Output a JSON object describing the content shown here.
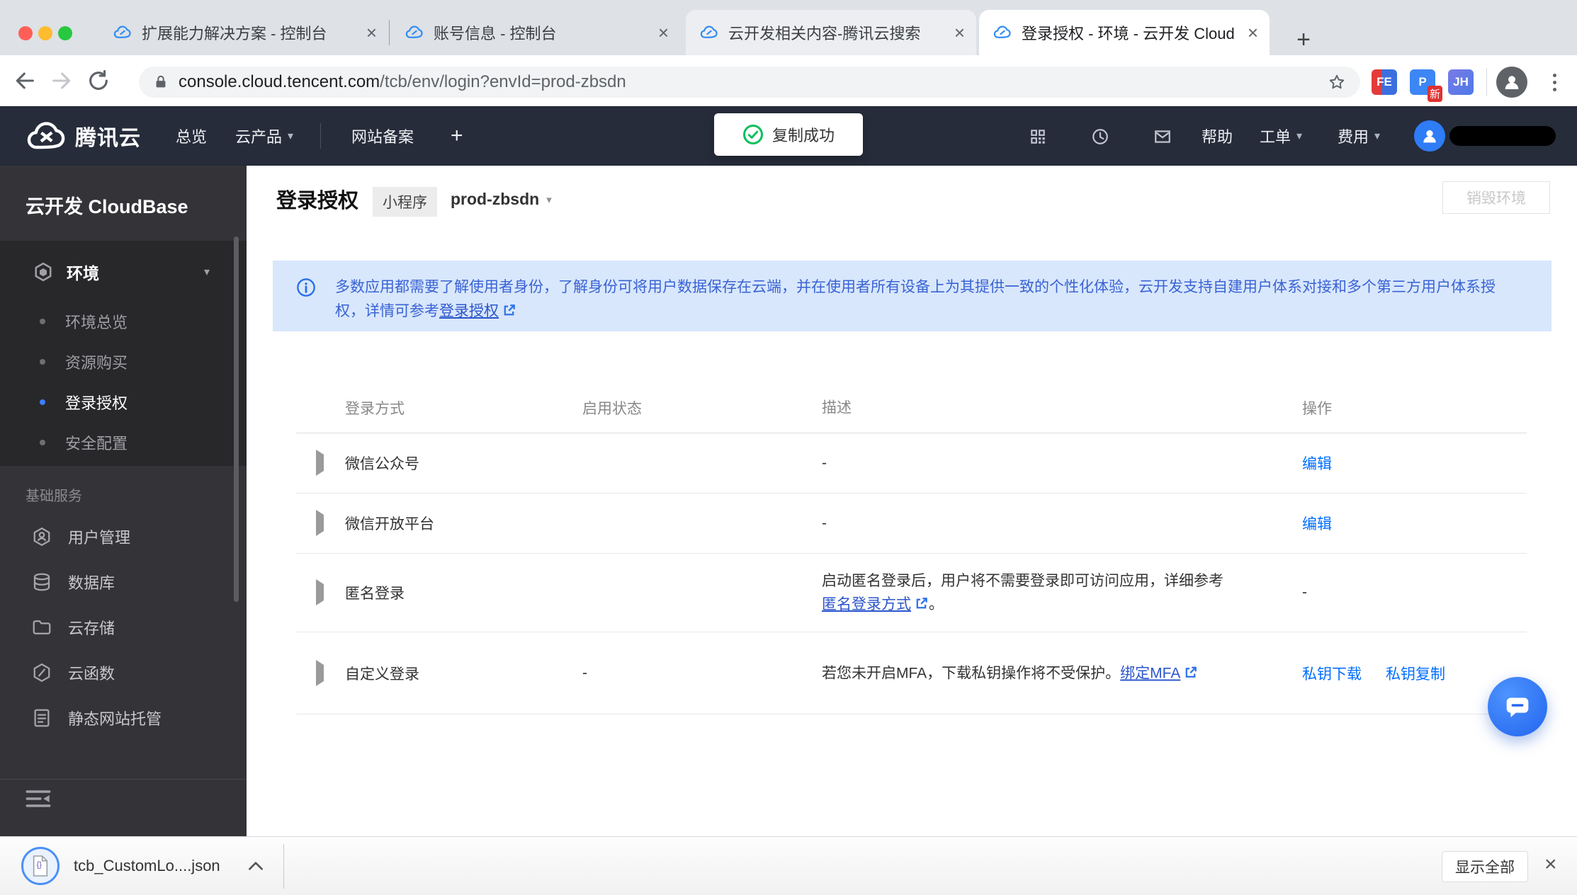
{
  "browser": {
    "tabs": [
      {
        "title": "扩展能力解决方案 - 控制台"
      },
      {
        "title": "账号信息 - 控制台"
      },
      {
        "title": "云开发相关内容-腾讯云搜索"
      },
      {
        "title": "登录授权 - 环境 - 云开发 Cloud"
      }
    ],
    "url_host": "console.cloud.tencent.com",
    "url_path": "/tcb/env/login?envId=prod-zbsdn",
    "extensions": {
      "fe": "FE",
      "p": "P",
      "jh": "JH",
      "p_badge": "新"
    }
  },
  "topnav": {
    "brand": "腾讯云",
    "overview": "总览",
    "products": "云产品",
    "icp": "网站备案",
    "toast": "复制成功",
    "help": "帮助",
    "ticket": "工单",
    "billing": "费用"
  },
  "sidebar": {
    "title": "云开发 CloudBase",
    "env_group": "环境",
    "env_items": [
      {
        "label": "环境总览"
      },
      {
        "label": "资源购买"
      },
      {
        "label": "登录授权"
      },
      {
        "label": "安全配置"
      }
    ],
    "section": "基础服务",
    "services": [
      {
        "label": "用户管理"
      },
      {
        "label": "数据库"
      },
      {
        "label": "云存储"
      },
      {
        "label": "云函数"
      },
      {
        "label": "静态网站托管"
      }
    ]
  },
  "main": {
    "page_title": "登录授权",
    "env_type": "小程序",
    "env_id": "prod-zbsdn",
    "destroy": "销毁环境",
    "banner": {
      "text": "多数应用都需要了解使用者身份，了解身份可将用户数据保存在云端，并在使用者所有设备上为其提供一致的个性化体验，云开发支持自建用户体系对接和多个第三方用户体系授权，详情可参考",
      "link": "登录授权"
    },
    "table": {
      "headers": {
        "method": "登录方式",
        "status": "启用状态",
        "desc": "描述",
        "ops": "操作"
      },
      "rows": [
        {
          "name": "微信公众号",
          "desc": "-",
          "op": "编辑"
        },
        {
          "name": "微信开放平台",
          "desc": "-",
          "op": "编辑"
        },
        {
          "name": "匿名登录",
          "desc_text": "启动匿名登录后，用户将不需要登录即可访问应用，详细参考",
          "desc_link": "匿名登录方式",
          "desc_suffix": "。",
          "op": "-"
        },
        {
          "name": "自定义登录",
          "status": "-",
          "desc_text": "若您未开启MFA，下载私钥操作将不受保护。",
          "desc_link": "绑定MFA",
          "op1": "私钥下载",
          "op2": "私钥复制"
        }
      ]
    }
  },
  "downloads": {
    "filename": "tcb_CustomLo....json",
    "show_all": "显示全部"
  },
  "icons": {
    "close": "×",
    "plus": "+",
    "caret_down": "▾"
  },
  "colors": {
    "accent_blue": "#006EFF",
    "banner_bg": "#D8E7FC",
    "banner_text": "#3A63D4",
    "toggle_off": "#8A8F96",
    "topnav_bg": "#262C3A",
    "toast_green": "#0ABF5B"
  }
}
